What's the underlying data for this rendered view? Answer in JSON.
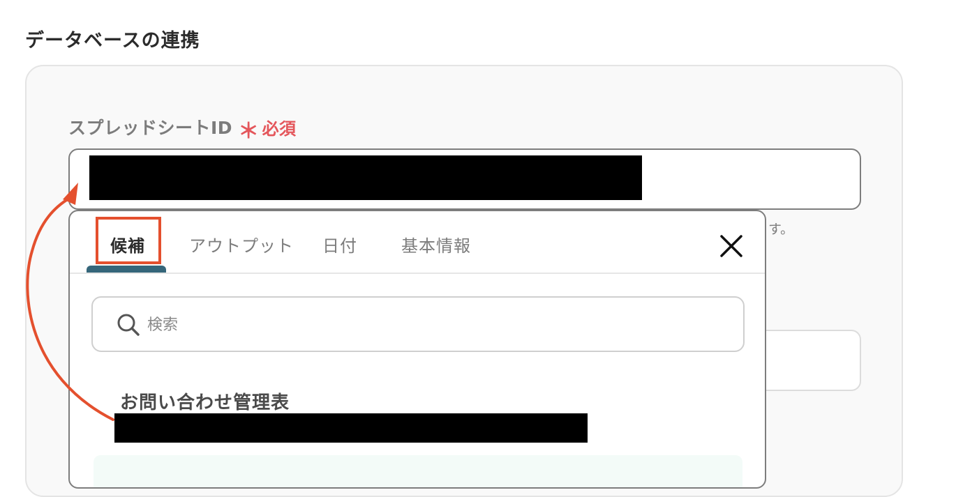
{
  "section": {
    "title": "データベースの連携"
  },
  "field": {
    "label": "スプレッドシートID",
    "required_mark": "＊",
    "required_text": "必須",
    "help_tail": "す。"
  },
  "popup": {
    "tabs": [
      {
        "label": "候補",
        "active": true
      },
      {
        "label": "アウトプット",
        "active": false
      },
      {
        "label": "日付",
        "active": false
      },
      {
        "label": "基本情報",
        "active": false
      }
    ],
    "search_placeholder": "検索",
    "candidate": {
      "title": "お問い合わせ管理表"
    },
    "close_icon": "close-icon"
  },
  "colors": {
    "required": "#e4565b",
    "tab_underline": "#35667a",
    "highlight": "#e4502e",
    "arrow": "#e4502e"
  }
}
